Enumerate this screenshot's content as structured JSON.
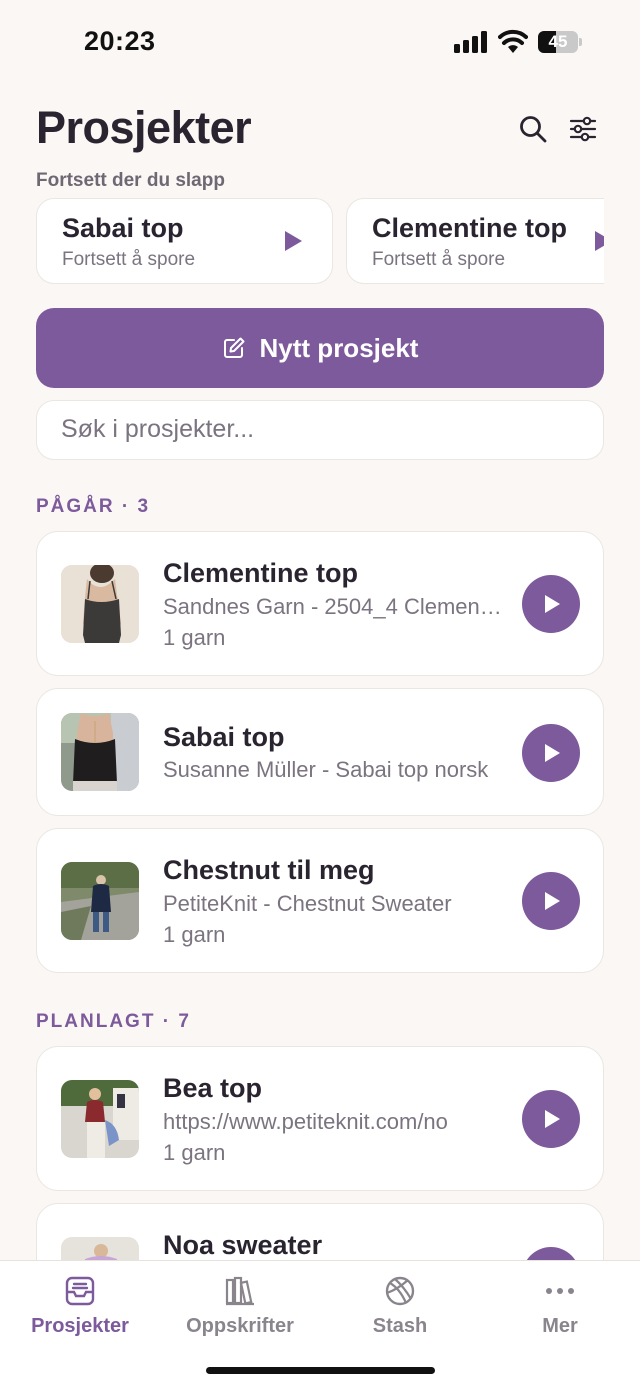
{
  "status_bar": {
    "time": "20:23",
    "battery_level": "45",
    "battery_fraction": 0.45
  },
  "header": {
    "title": "Prosjekter",
    "search_icon": "search-icon",
    "filter_icon": "sliders-icon"
  },
  "continue": {
    "caption": "Fortsett der du slapp",
    "cards": [
      {
        "title": "Sabai top",
        "subtitle": "Fortsett å spore"
      },
      {
        "title": "Clementine top",
        "subtitle": "Fortsett å spore"
      }
    ]
  },
  "new_project": {
    "label": "Nytt prosjekt",
    "icon": "edit-icon"
  },
  "search": {
    "placeholder": "Søk i prosjekter..."
  },
  "groups": {
    "in_progress": {
      "heading": "PÅGÅR · 3",
      "items": [
        {
          "name": "Clementine top",
          "source": "Sandnes Garn - 2504_4 Clementine top",
          "yarn": "1 garn"
        },
        {
          "name": "Sabai top",
          "source": "Susanne Müller - Sabai top norsk",
          "yarn": ""
        },
        {
          "name": "Chestnut til meg",
          "source": "PetiteKnit - Chestnut Sweater",
          "yarn": "1 garn"
        }
      ]
    },
    "planned": {
      "heading": "PLANLAGT · 7",
      "items": [
        {
          "name": "Bea top",
          "source": "https://www.petiteknit.com/no",
          "yarn": "1 garn"
        },
        {
          "name": "Noa sweater",
          "source": "",
          "yarn": ""
        }
      ]
    }
  },
  "tab_bar": {
    "tabs": [
      {
        "label": "Prosjekter",
        "icon": "tray-icon",
        "active": true
      },
      {
        "label": "Oppskrifter",
        "icon": "books-icon",
        "active": false
      },
      {
        "label": "Stash",
        "icon": "yarn-ball-icon",
        "active": false
      },
      {
        "label": "Mer",
        "icon": "more-icon",
        "active": false
      }
    ]
  },
  "colors": {
    "accent": "#7d5a9b",
    "background": "#faf7f4",
    "text": "#2a2430",
    "muted": "#7b7480"
  }
}
